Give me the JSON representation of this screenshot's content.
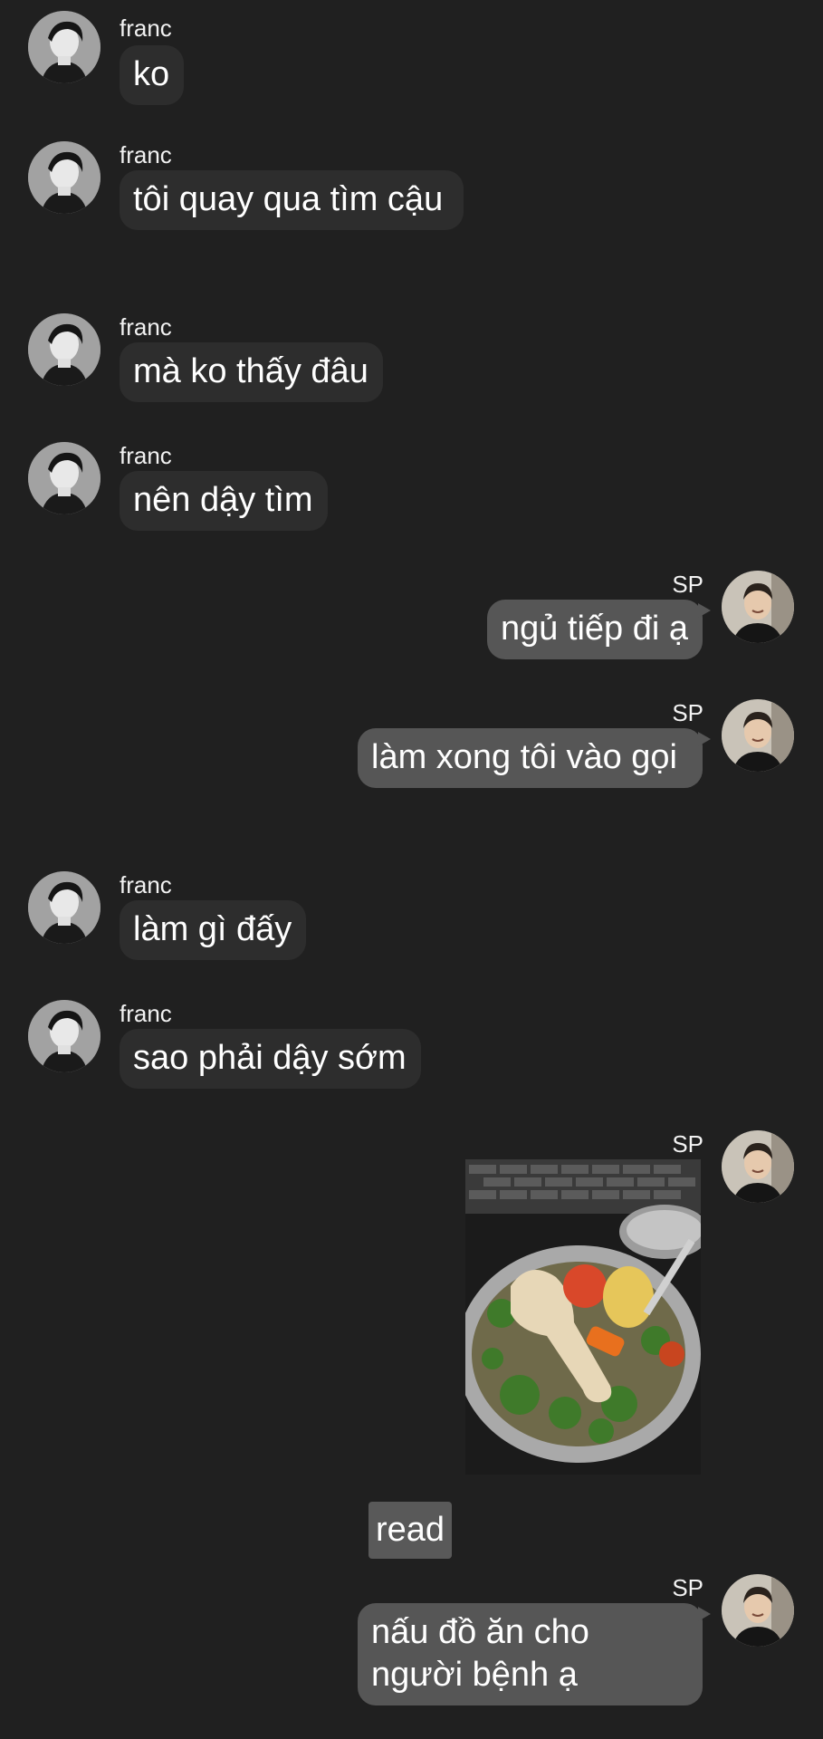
{
  "contacts": {
    "franc": "franc",
    "sp": "SP"
  },
  "messages": [
    {
      "side": "in",
      "sender": "franc",
      "text": "ko"
    },
    {
      "side": "in",
      "sender": "franc",
      "text": "tôi quay qua tìm cậu"
    },
    {
      "side": "in",
      "sender": "franc",
      "text": "mà ko thấy đâu"
    },
    {
      "side": "in",
      "sender": "franc",
      "text": "nên dậy tìm"
    },
    {
      "side": "out",
      "sender": "SP",
      "text": "ngủ tiếp đi ạ"
    },
    {
      "side": "out",
      "sender": "SP",
      "text": "làm xong tôi vào gọi"
    },
    {
      "side": "in",
      "sender": "franc",
      "text": "làm gì đấy"
    },
    {
      "side": "in",
      "sender": "franc",
      "text": "sao phải dậy sớm"
    },
    {
      "side": "out",
      "sender": "SP",
      "type": "image",
      "image_desc": "chicken-soup-photo"
    },
    {
      "side": "out",
      "sender": "SP",
      "text": "nấu đồ ăn cho người bệnh ạ"
    }
  ],
  "read_receipt": "read",
  "colors": {
    "background": "#202020",
    "incoming_bubble": "#2d2d2d",
    "outgoing_bubble": "#565656",
    "read_badge": "#595959"
  }
}
